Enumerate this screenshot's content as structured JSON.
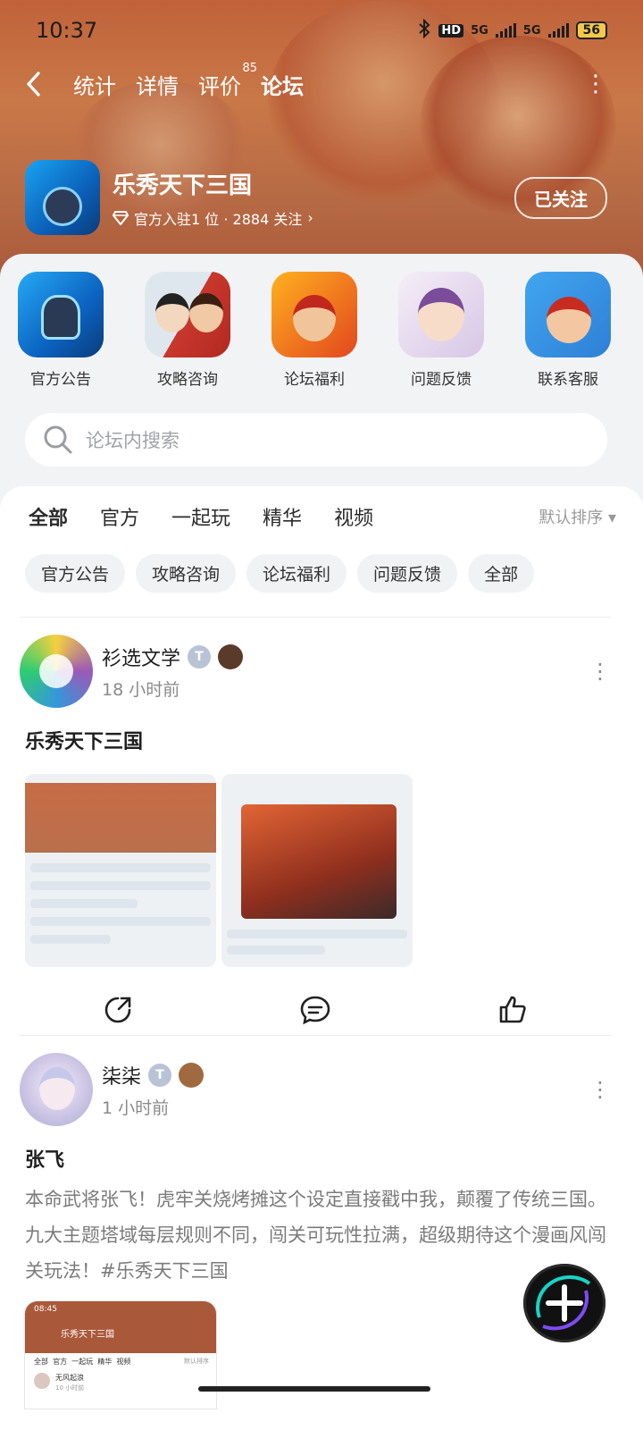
{
  "status_bar": {
    "time": "10:37",
    "hd_label": "HD",
    "net1": "5G",
    "net2": "5G",
    "battery": "56"
  },
  "nav": {
    "tabs": [
      {
        "label": "统计"
      },
      {
        "label": "详情"
      },
      {
        "label": "评价",
        "count": "85"
      },
      {
        "label": "论坛"
      }
    ],
    "active_tab": "论坛"
  },
  "game": {
    "name": "乐秀天下三国",
    "meta": "官方入驻1 位 · 2884 关注",
    "follow_label": "已关注"
  },
  "quick_links": [
    {
      "label": "官方公告"
    },
    {
      "label": "攻略咨询"
    },
    {
      "label": "论坛福利"
    },
    {
      "label": "问题反馈"
    },
    {
      "label": "联系客服"
    }
  ],
  "search": {
    "placeholder": "论坛内搜索"
  },
  "filter_tabs": [
    {
      "label": "全部"
    },
    {
      "label": "官方"
    },
    {
      "label": "一起玩"
    },
    {
      "label": "精华"
    },
    {
      "label": "视频"
    }
  ],
  "sort_label": "默认排序",
  "chips": [
    "官方公告",
    "攻略咨询",
    "论坛福利",
    "问题反馈",
    "全部"
  ],
  "posts": [
    {
      "author": "衫选文学",
      "time": "18 小时前",
      "title": "乐秀天下三国",
      "badge": "T"
    },
    {
      "author": "柒柒",
      "time": "1 小时前",
      "title": "张飞",
      "body": "本命武将张飞！虎牢关烧烤摊这个设定直接戳中我，颠覆了传统三国。九大主题塔域每层规则不同，闯关可玩性拉满，超级期待这个漫画风闯关玩法！#乐秀天下三国",
      "badge": "T",
      "thumb_time": "08:45",
      "thumb_title": "乐秀天下三国",
      "thumb_tabs": "全部  官方  一起玩  精华  视频",
      "thumb_sort": "默认排序",
      "thumb_user": "无风起浪",
      "thumb_user_time": "10 小时前"
    }
  ],
  "colors": {
    "accent": "#19d3c5",
    "hero": "#c0623a"
  }
}
